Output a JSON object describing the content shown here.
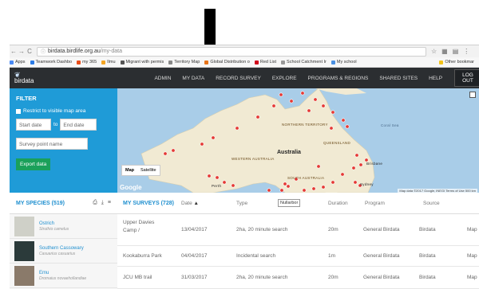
{
  "browser": {
    "url_host": "birdata.birdlife.org.au",
    "url_path": "/my-data",
    "back": "←",
    "forward": "→",
    "reload": "C",
    "star": "☆",
    "bookmarks": [
      {
        "label": "Apps",
        "color": "#4a8af4"
      },
      {
        "label": "Teamwork Dashbo",
        "color": "#2c7be5"
      },
      {
        "label": "my 365",
        "color": "#e94e1b"
      },
      {
        "label": "Ilmu",
        "color": "#f5a623"
      },
      {
        "label": "Migrant with permis",
        "color": "#555555"
      },
      {
        "label": "Territory Map",
        "color": "#888888"
      },
      {
        "label": "Global Distribution o",
        "color": "#e8751a"
      },
      {
        "label": "Red List",
        "color": "#d0021b"
      },
      {
        "label": "School Catchment Ir",
        "color": "#999999"
      },
      {
        "label": "My school",
        "color": "#4a90e2"
      },
      {
        "label": "Other bookmar",
        "color": "#f3c31a"
      }
    ]
  },
  "nav": {
    "logo": "birdata",
    "links": [
      "ADMIN",
      "MY DATA",
      "RECORD SURVEY",
      "EXPLORE",
      "PROGRAMS & REGIONS",
      "SHARED SITES",
      "HELP"
    ],
    "logout": "LOG OUT"
  },
  "filter": {
    "title": "FILTER",
    "restrict": "Restrict to visible map area",
    "start_placeholder": "Start date",
    "to": "to",
    "end_placeholder": "End date",
    "survey_point_placeholder": "Survey point name",
    "export": "Export data"
  },
  "map": {
    "country": "Australia",
    "regions": {
      "nt": "NORTHERN TERRITORY",
      "qld": "QUEENSLAND",
      "wa": "WESTERN AUSTRALIA",
      "sa": "SOUTH AUSTRALIA",
      "sea": "Coral Sea",
      "brisbane": "Brisbane",
      "perth": "Perth",
      "sydney": "Sydney"
    },
    "map_button": "Map",
    "satellite_button": "Satellite",
    "google": "Google",
    "attribution": "Map data ©2017 Google, INEGI   Terms of Use   500 km",
    "land_color": "#f1ead3",
    "sea_color": "#a9cde8",
    "marker_color": "#e53935"
  },
  "species": {
    "title": "MY SPECIES (519)",
    "items": [
      {
        "common": "Ostrich",
        "scientific": "Struthio camelus",
        "thumb_color": "#cfd0c8"
      },
      {
        "common": "Southern Cassowary",
        "scientific": "Casuarius casuarius",
        "thumb_color": "#2b3a3a"
      },
      {
        "common": "Emu",
        "scientific": "Dromaius novaehollandiae",
        "thumb_color": "#8a7a6a"
      }
    ]
  },
  "surveys": {
    "title": "MY SURVEYS (728)",
    "columns": {
      "date": "Date",
      "sort": "▲",
      "type": "Type",
      "duration": "Duration",
      "program": "Program",
      "source": "Source"
    },
    "tooltip": "Nullarbor",
    "rows": [
      {
        "name1": "Upper Davies",
        "name2": "Camp /",
        "date": "13/04/2017",
        "type": "2ha, 20 minute search",
        "duration": "20m",
        "program": "General Birdata",
        "source": "Birdata",
        "extra": "Map"
      },
      {
        "name1": "Kookaburra Park",
        "name2": "",
        "date": "04/04/2017",
        "type": "Incidental search",
        "duration": "1m",
        "program": "General Birdata",
        "source": "Birdata",
        "extra": "Map"
      },
      {
        "name1": "JCU MB trail",
        "name2": "",
        "date": "31/03/2017",
        "type": "2ha, 20 minute search",
        "duration": "20m",
        "program": "General Birdata",
        "source": "Birdata",
        "extra": "Map"
      }
    ]
  }
}
